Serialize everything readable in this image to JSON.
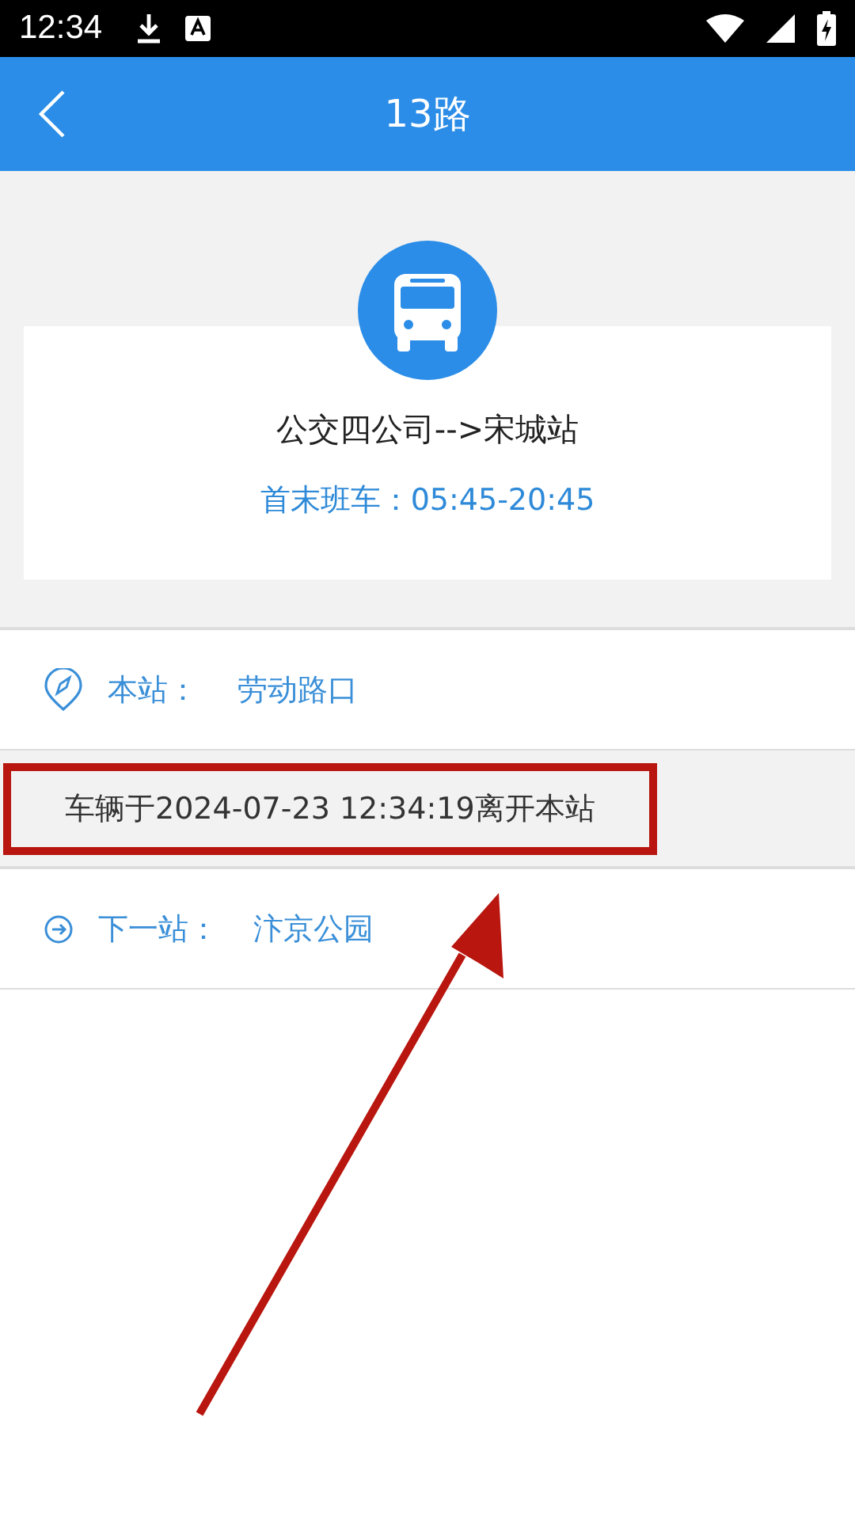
{
  "status_bar": {
    "time": "12:34"
  },
  "app_bar": {
    "title": "13路"
  },
  "route": {
    "direction": "公交四公司-->宋城站",
    "hours": "首末班车：05:45-20:45"
  },
  "stations": [
    {
      "kind": "current",
      "label": "本站：",
      "name": "劳动路口"
    },
    {
      "kind": "notice",
      "text": "车辆于2024-07-23 12:34:19离开本站",
      "highlighted": true
    },
    {
      "kind": "next",
      "label": "下一站：",
      "name": "汴京公园"
    }
  ],
  "annotation": {
    "arrow": true
  }
}
